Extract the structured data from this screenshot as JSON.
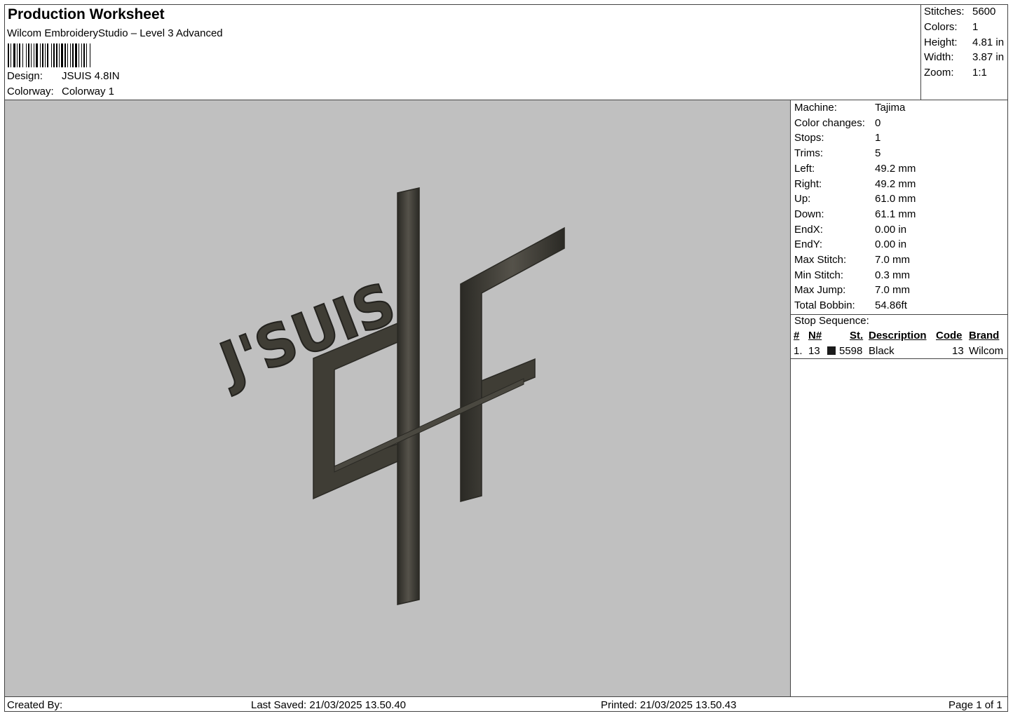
{
  "header": {
    "title": "Production Worksheet",
    "subtitle": "Wilcom EmbroideryStudio – Level 3 Advanced",
    "design_label": "Design:",
    "design_value": "JSUIS 4.8IN",
    "colorway_label": "Colorway:",
    "colorway_value": "Colorway 1"
  },
  "summary": [
    {
      "label": "Stitches:",
      "value": "5600"
    },
    {
      "label": "Colors:",
      "value": "1"
    },
    {
      "label": "Height:",
      "value": "4.81 in"
    },
    {
      "label": "Width:",
      "value": "3.87 in"
    },
    {
      "label": "Zoom:",
      "value": "1:1"
    }
  ],
  "machine_info": [
    {
      "label": "Machine:",
      "value": "Tajima"
    },
    {
      "label": "Color changes:",
      "value": "0"
    },
    {
      "label": "Stops:",
      "value": "1"
    },
    {
      "label": "Trims:",
      "value": "5"
    },
    {
      "label": "Left:",
      "value": "49.2 mm"
    },
    {
      "label": "Right:",
      "value": "49.2 mm"
    },
    {
      "label": "Up:",
      "value": "61.0 mm"
    },
    {
      "label": "Down:",
      "value": "61.1 mm"
    },
    {
      "label": "EndX:",
      "value": "0.00 in"
    },
    {
      "label": "EndY:",
      "value": "0.00 in"
    },
    {
      "label": "Max Stitch:",
      "value": "7.0 mm"
    },
    {
      "label": "Min Stitch:",
      "value": "0.3 mm"
    },
    {
      "label": "Max Jump:",
      "value": "7.0 mm"
    },
    {
      "label": "Total Bobbin:",
      "value": "54.86ft"
    }
  ],
  "stop_sequence": {
    "title": "Stop Sequence:",
    "columns": [
      "#",
      "N#",
      "St.",
      "Description",
      "Code",
      "Brand"
    ],
    "rows": [
      {
        "index": "1.",
        "n": "13",
        "swatch_color": "#1a1a1a",
        "stitches": "5598",
        "description": "Black",
        "code": "13",
        "brand": "Wilcom"
      }
    ]
  },
  "design_preview": {
    "text": "J'SUIS",
    "background_color": "#c0c0c0",
    "thread_color": "#3f3d35"
  },
  "footer": {
    "created_by": "Created By:",
    "last_saved": "Last Saved: 21/03/2025 13.50.40",
    "printed": "Printed: 21/03/2025 13.50.43",
    "page": "Page 1 of 1"
  }
}
